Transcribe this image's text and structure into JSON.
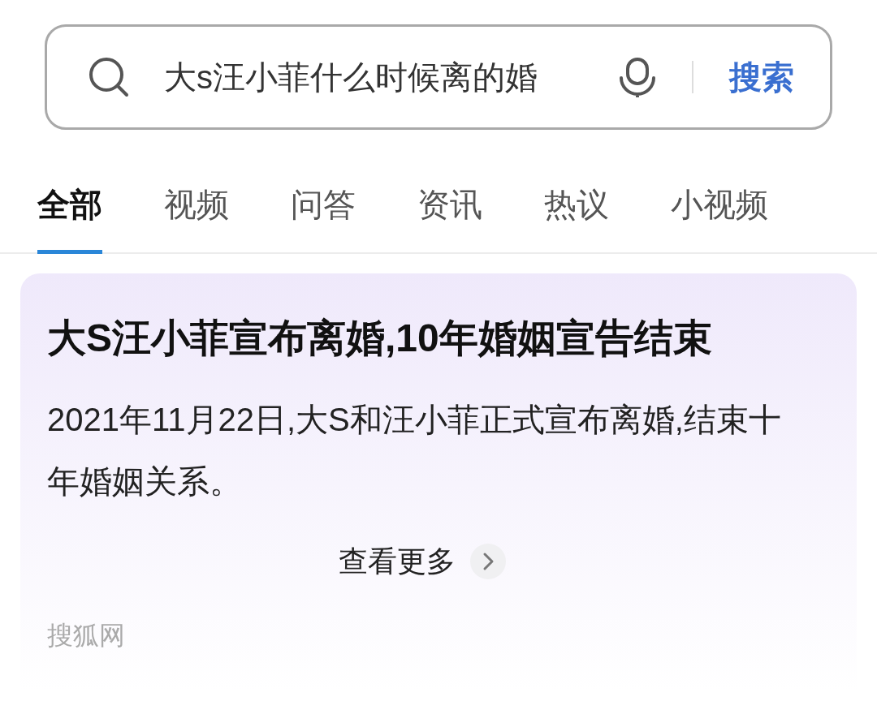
{
  "search": {
    "value": "大s汪小菲什么时候离的婚",
    "button": "搜索"
  },
  "tabs": [
    {
      "label": "全部",
      "selected": true
    },
    {
      "label": "视频",
      "selected": false
    },
    {
      "label": "问答",
      "selected": false
    },
    {
      "label": "资讯",
      "selected": false
    },
    {
      "label": "热议",
      "selected": false
    },
    {
      "label": "小视频",
      "selected": false
    }
  ],
  "result": {
    "title": "大S汪小菲宣布离婚,10年婚姻宣告结束",
    "summary": "2021年11月22日,大S和汪小菲正式宣布离婚,结束十年婚姻关系。",
    "more": "查看更多"
  },
  "source": "搜狐网"
}
